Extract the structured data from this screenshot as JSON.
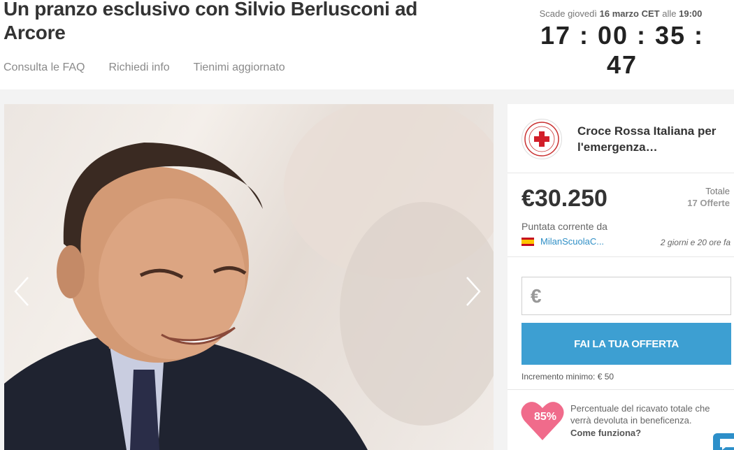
{
  "header": {
    "title": "Un pranzo esclusivo con Silvio Berlusconi ad Arcore",
    "links": [
      "Consulta le FAQ",
      "Richiedi info",
      "Tienimi aggiornato"
    ],
    "expiry_prefix": "Scade giovedì",
    "expiry_date": "16 marzo CET",
    "expiry_mid": "alle",
    "expiry_time": "19:00",
    "countdown": "17 : 00 : 35 : 47"
  },
  "gallery": {
    "prev_icon": "chevron-left-icon",
    "next_icon": "chevron-right-icon"
  },
  "charity": {
    "name": "Croce Rossa Italiana per l'emergenza…",
    "logo_icon": "red-cross-icon"
  },
  "bid": {
    "price": "€30.250",
    "total_label": "Totale",
    "total_count": "17 Offerte",
    "current_label": "Puntata corrente da",
    "bidder": "MilanScuolaC...",
    "bid_time": "2 giorni e 20 ore fa"
  },
  "offer": {
    "currency_symbol": "€",
    "input_value": "",
    "button_label": "FAI LA TUA OFFERTA",
    "min_increment": "Incremento minimo: € 50"
  },
  "donation": {
    "percent": "85%",
    "description": "Percentuale del ricavato totale che verrà devoluta in beneficenza.",
    "how_link": "Come funziona?"
  },
  "colors": {
    "accent_blue": "#3d9fd2",
    "heart_pink": "#f06b8b",
    "link_blue": "#2f8fc6"
  }
}
